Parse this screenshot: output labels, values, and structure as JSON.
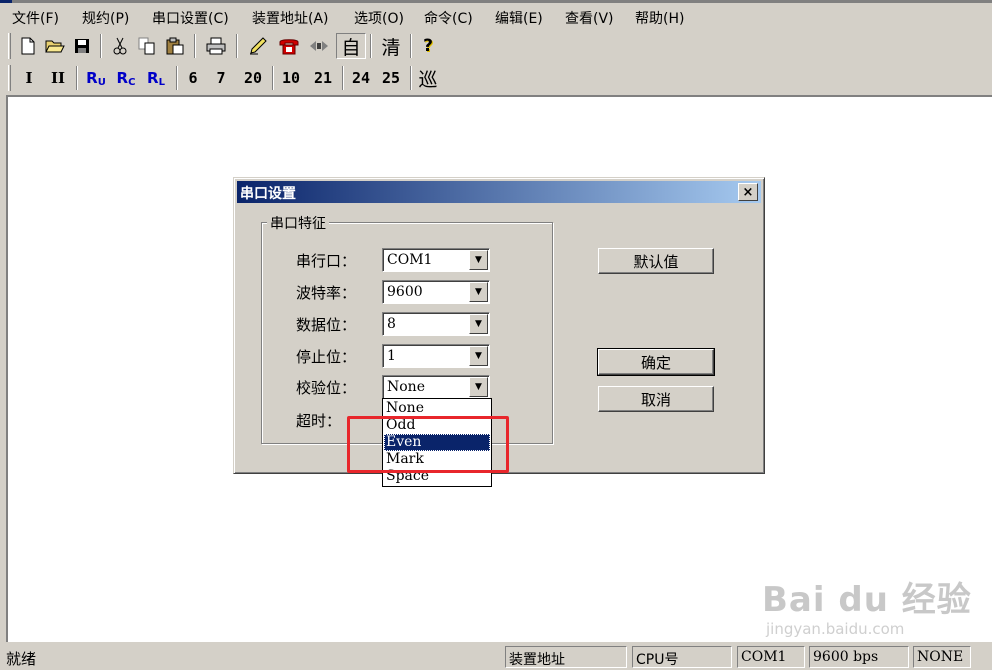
{
  "menu": {
    "items": [
      "文件(F)",
      "规约(P)",
      "串口设置(C)",
      "装置地址(A)",
      "选项(O)",
      "命令(C)",
      "编辑(E)",
      "查看(V)",
      "帮助(H)"
    ]
  },
  "toolbar1": {
    "new_icon": "new-file-icon",
    "open_icon": "open-folder-icon",
    "save_icon": "save-disk-icon",
    "cut_icon": "cut-icon",
    "copy_icon": "copy-icon",
    "paste_icon": "paste-icon",
    "print_icon": "print-icon",
    "pen_icon": "pen-icon",
    "phone_icon": "phone-icon",
    "connect_icon": "connect-icon",
    "auto_label": "自",
    "clear_label": "清",
    "help_label": "?"
  },
  "toolbar2": {
    "i1": "I",
    "i2": "II",
    "ru": "R",
    "ru_sub": "U",
    "rc": "R",
    "rc_sub": "C",
    "rl": "R",
    "rl_sub": "L",
    "b6": "6",
    "b7": "7",
    "b20": "20",
    "b10": "10",
    "b21": "21",
    "b24": "24",
    "b25": "25",
    "patrol": "巡"
  },
  "dialog": {
    "title": "串口设置",
    "close_label": "×",
    "group_label": "串口特征",
    "fields": [
      {
        "label": "串行口：",
        "value": "COM1"
      },
      {
        "label": "波特率：",
        "value": "9600"
      },
      {
        "label": "数据位：",
        "value": "8"
      },
      {
        "label": "停止位：",
        "value": "1"
      },
      {
        "label": "校验位：",
        "value": "None"
      }
    ],
    "timeout_label": "超时：",
    "buttons": {
      "default": "默认值",
      "ok": "确定",
      "cancel": "取消"
    },
    "parity_options": [
      "None",
      "Odd",
      "Even",
      "Mark",
      "Space"
    ],
    "parity_selected": "Even"
  },
  "status": {
    "ready": "就绪",
    "device_address": "装置地址",
    "cpu": "CPU号",
    "port": "COM1",
    "baud": "9600 bps",
    "parity": "NONE"
  },
  "watermark": {
    "brand": "Bai du 经验",
    "site": "jingyan.baidu.com"
  },
  "colors": {
    "title_bar": "#0a246a",
    "highlight": "#e8262b",
    "selection": "#0a246a"
  }
}
